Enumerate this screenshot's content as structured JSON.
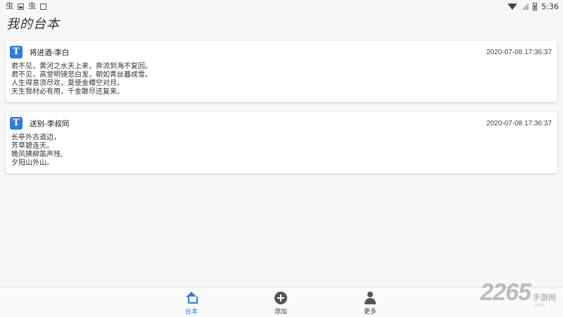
{
  "status_bar": {
    "left_glyphs": [
      "虫",
      "虫"
    ],
    "time": "5:36"
  },
  "page_title": "我的台本",
  "scripts": [
    {
      "icon_letter": "T",
      "title": "将进酒-李白",
      "date": "2020-07-08 17:36:37",
      "lines": [
        "君不见，黄河之水天上来，奔流到海不复回。",
        "君不见，高堂明镜悲白发，朝如青丝暮成雪。",
        "人生得意须尽欢，莫使金樽空对月。",
        "天生我材必有用，千金散尽还复来。"
      ]
    },
    {
      "icon_letter": "T",
      "title": "送别-李叔同",
      "date": "2020-07-08 17:36:37",
      "lines": [
        "长亭外古道边，",
        "芳草碧连天。",
        "晚风拂柳笛声残,",
        "夕阳山外山。"
      ]
    }
  ],
  "bottom_nav": {
    "items": [
      {
        "label": "台本",
        "icon": "home-icon",
        "active": true
      },
      {
        "label": "添加",
        "icon": "add-circle-icon",
        "active": false
      },
      {
        "label": "更多",
        "icon": "user-icon",
        "active": false
      }
    ]
  },
  "watermark": {
    "number": "2265",
    "brand": "手游网",
    "url": ".com"
  },
  "colors": {
    "accent": "#2f7ae5",
    "background": "#f7f7f7",
    "card": "#ffffff"
  }
}
